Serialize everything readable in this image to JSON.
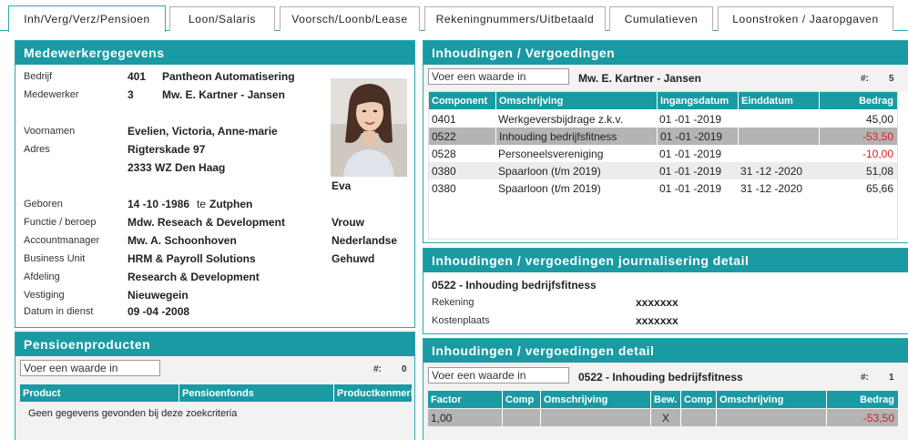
{
  "tabs": [
    {
      "label": "Inh/Verg/Verz/Pensioen",
      "active": true
    },
    {
      "label": "Loon/Salaris",
      "active": false
    },
    {
      "label": "Voorsch/Loonb/Lease",
      "active": false
    },
    {
      "label": "Rekeningnummers/Uitbetaald",
      "active": false
    },
    {
      "label": "Cumulatieven",
      "active": false
    },
    {
      "label": "Loonstroken / Jaaropgaven",
      "active": false
    }
  ],
  "employee": {
    "title": "Medewerkergegevens",
    "bedrijf_label": "Bedrijf",
    "bedrijf_code": "401",
    "bedrijf_name": "Pantheon Automatisering",
    "medewerker_label": "Medewerker",
    "medewerker_code": "3",
    "medewerker_name": "Mw. E. Kartner - Jansen",
    "voornamen_label": "Voornamen",
    "voornamen": "Evelien, Victoria, Anne-marie",
    "adres_label": "Adres",
    "adres_line1": "Rigterskade 97",
    "adres_line2": "2333 WZ Den Haag",
    "roepnaam": "Eva",
    "geboren_label": "Geboren",
    "geboren_datum": "14 -10 -1986",
    "geboren_te": "te",
    "geboren_plaats": "Zutphen",
    "functie_label": "Functie / beroep",
    "functie": "Mdw. Reseach & Development",
    "account_label": "Accountmanager",
    "account": "Mw. A. Schoonhoven",
    "unit_label": "Business Unit",
    "unit": "HRM & Payroll Solutions",
    "afdeling_label": "Afdeling",
    "afdeling": "Research & Development",
    "vestiging_label": "Vestiging",
    "vestiging": "Nieuwegein",
    "dienst_label": "Datum in dienst",
    "dienst": "09 -04 -2008",
    "geslacht": "Vrouw",
    "nationaliteit": "Nederlandse",
    "burgerlijke_staat": "Gehuwd"
  },
  "pension": {
    "title": "Pensioenproducten",
    "search_placeholder": "Voer een waarde in",
    "count_label": "#:",
    "count": "0",
    "columns": [
      "Product",
      "Pensioenfonds",
      "Productkenmerk"
    ],
    "empty_text": "Geen gegevens gevonden bij deze zoekcriteria"
  },
  "deductions": {
    "title": "Inhoudingen / Vergoedingen",
    "search_placeholder": "Voer een waarde in",
    "employee_name": "Mw. E. Kartner - Jansen",
    "count_label": "#:",
    "count": "5",
    "columns": [
      "Component",
      "Omschrijving",
      "Ingangsdatum",
      "Einddatum",
      "Bedrag"
    ],
    "rows": [
      {
        "component": "0401",
        "omschrijving": "Werkgeversbijdrage z.k.v.",
        "ingang": "01 -01 -2019",
        "eind": "",
        "bedrag": "45,00",
        "negative": false
      },
      {
        "component": "0522",
        "omschrijving": "Inhouding bedrijfsfitness",
        "ingang": "01 -01 -2019",
        "eind": "",
        "bedrag": "-53,50",
        "negative": true
      },
      {
        "component": "0528",
        "omschrijving": "Personeelsvereniging",
        "ingang": "01 -01 -2019",
        "eind": "",
        "bedrag": "-10,00",
        "negative": true
      },
      {
        "component": "0380",
        "omschrijving": "Spaarloon (t/m 2019)",
        "ingang": "01 -01 -2019",
        "eind": "31 -12 -2020",
        "bedrag": "51,08",
        "negative": false
      },
      {
        "component": "0380",
        "omschrijving": "Spaarloon (t/m 2019)",
        "ingang": "01 -01 -2019",
        "eind": "31 -12 -2020",
        "bedrag": "65,66",
        "negative": false
      }
    ]
  },
  "journal": {
    "title": "Inhoudingen / vergoedingen journalisering detail",
    "heading": "0522 - Inhouding bedrijfsfitness",
    "rekening_label": "Rekening",
    "rekening": "xxxxxxx",
    "kostenplaats_label": "Kostenplaats",
    "kostenplaats": "xxxxxxx"
  },
  "detail": {
    "title": "Inhoudingen / vergoedingen detail",
    "search_placeholder": "Voer een waarde in",
    "heading": "0522 - Inhouding bedrijfsfitness",
    "count_label": "#:",
    "count": "1",
    "columns": [
      "Factor",
      "Comp",
      "Omschrijving",
      "Bew.",
      "Comp",
      "Omschrijving",
      "Bedrag"
    ],
    "rows": [
      {
        "factor": "1,00",
        "comp1": "",
        "omschr1": "",
        "bew": "X",
        "comp2": "",
        "omschr2": "",
        "bedrag": "-53,50"
      }
    ]
  }
}
